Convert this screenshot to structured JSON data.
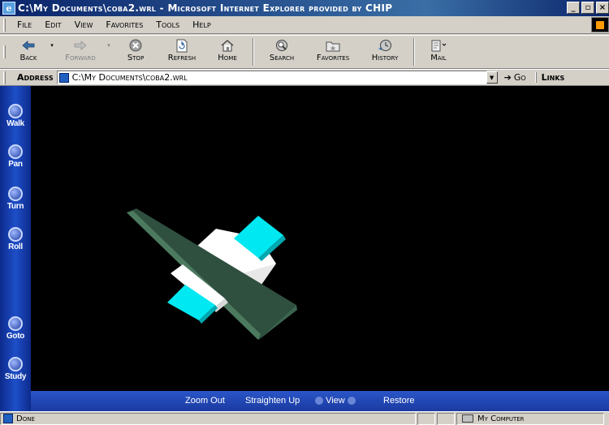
{
  "window": {
    "title": "C:\\My Documents\\coba2.wrl - Microsoft Internet Explorer provided by CHIP",
    "icon": "ie-page-icon"
  },
  "menu": [
    "File",
    "Edit",
    "View",
    "Favorites",
    "Tools",
    "Help"
  ],
  "toolbar": {
    "back": "Back",
    "forward": "Forward",
    "stop": "Stop",
    "refresh": "Refresh",
    "home": "Home",
    "search": "Search",
    "favorites": "Favorites",
    "history": "History",
    "mail": "Mail"
  },
  "address": {
    "label": "Address",
    "value": "C:\\My Documents\\coba2.wrl",
    "go": "Go",
    "links": "Links"
  },
  "vrml_nav": {
    "walk": "Walk",
    "pan": "Pan",
    "turn": "Turn",
    "roll": "Roll",
    "goto": "Goto",
    "study": "Study"
  },
  "vrml_console": {
    "zoom_out": "Zoom Out",
    "straighten_up": "Straighten Up",
    "view": "View",
    "restore": "Restore"
  },
  "status": {
    "text": "Done",
    "zone": "My Computer"
  },
  "colors": {
    "scene_bg": "#000000",
    "plate": "#2f4f3f",
    "plate_edge": "#3f6b52",
    "cyan": "#00e5f0",
    "white": "#ffffff"
  }
}
